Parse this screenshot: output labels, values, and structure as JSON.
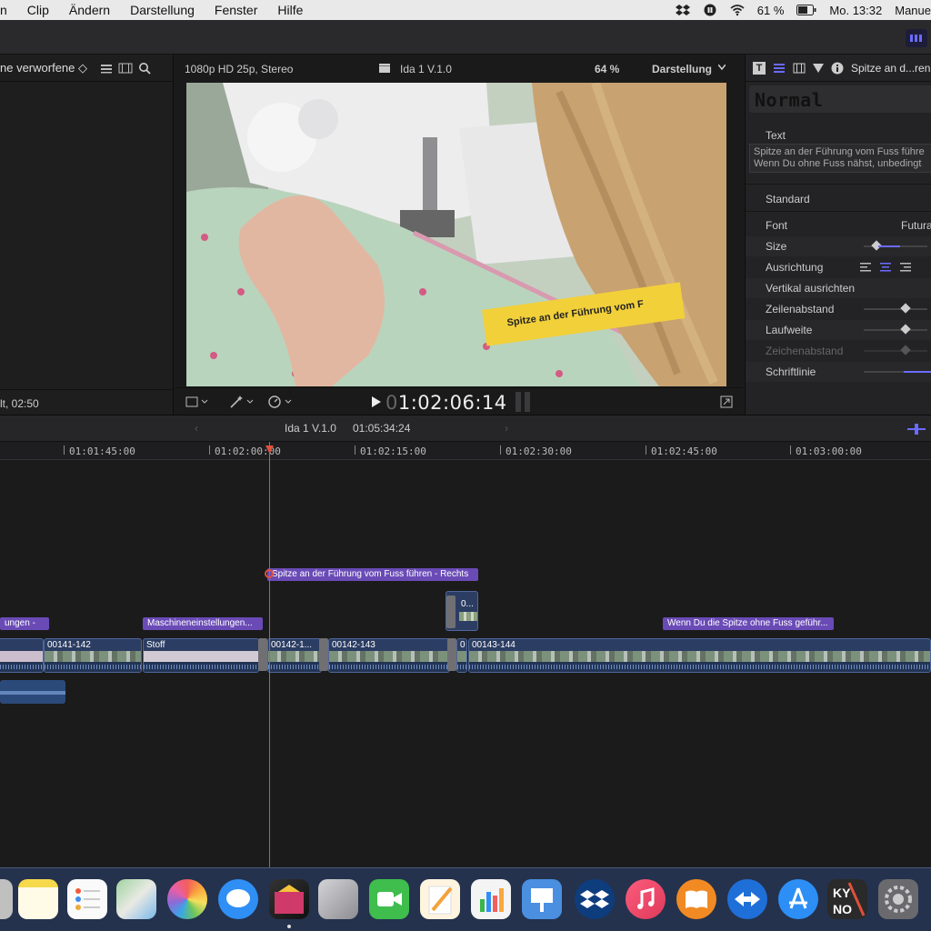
{
  "menubar": {
    "items": [
      "n",
      "Clip",
      "Ändern",
      "Darstellung",
      "Fenster",
      "Hilfe"
    ],
    "battery": "61 %",
    "clock": "Mo. 13:32",
    "user": "Manue"
  },
  "browser": {
    "filter": "ne verworfene ◇",
    "footer": "lt, 02:50"
  },
  "viewer": {
    "format": "1080p HD 25p, Stereo",
    "project": "Ida 1 V.1.0",
    "zoom": "64 %",
    "display_menu": "Darstellung",
    "timecode_dim": "0",
    "timecode": "1:02:06:14",
    "overlay_text": "Spitze an der Führung vom F"
  },
  "inspector": {
    "clip_name": "Spitze an d...ren",
    "preset": "Normal",
    "text_section": "Text",
    "text_line1": "Spitze an der Führung vom Fuss führe",
    "text_line2": "Wenn Du ohne Fuss nähst, unbedingt",
    "standard": "Standard",
    "rows": [
      {
        "label": "Font",
        "value": "Futura"
      },
      {
        "label": "Size",
        "value": ""
      },
      {
        "label": "Ausrichtung",
        "value": ""
      },
      {
        "label": "Vertikal ausrichten",
        "value": ""
      },
      {
        "label": "Zeilenabstand",
        "value": ""
      },
      {
        "label": "Laufweite",
        "value": ""
      },
      {
        "label": "Zeichenabstand",
        "value": ""
      },
      {
        "label": "Schriftlinie",
        "value": ""
      }
    ]
  },
  "timeline": {
    "project": "Ida 1 V.1.0",
    "duration": "01:05:34:24",
    "ruler": [
      "01:01:45:00",
      "01:02:00:00",
      "01:02:15:00",
      "01:02:30:00",
      "01:02:45:00",
      "01:03:00:00"
    ],
    "titles": {
      "t1": "Spitze an der Führung vom Fuss führen - Rechts",
      "t2": "ungen  -",
      "t3": "Maschineneinstellungen...",
      "t4": "Wenn Du die Spitze ohne Fuss geführ..."
    },
    "clips": {
      "c1": "00141-142",
      "c2": "Stoff",
      "c3": "00142-1...",
      "c4": "00142-143",
      "c5": "0",
      "c6": "00143-144",
      "c7": "0..."
    }
  },
  "colors": {
    "accent": "#5b5bff",
    "playhead": "#e0503a",
    "title_clip": "#6a4bb6",
    "video_clip": "#2c3d63"
  }
}
